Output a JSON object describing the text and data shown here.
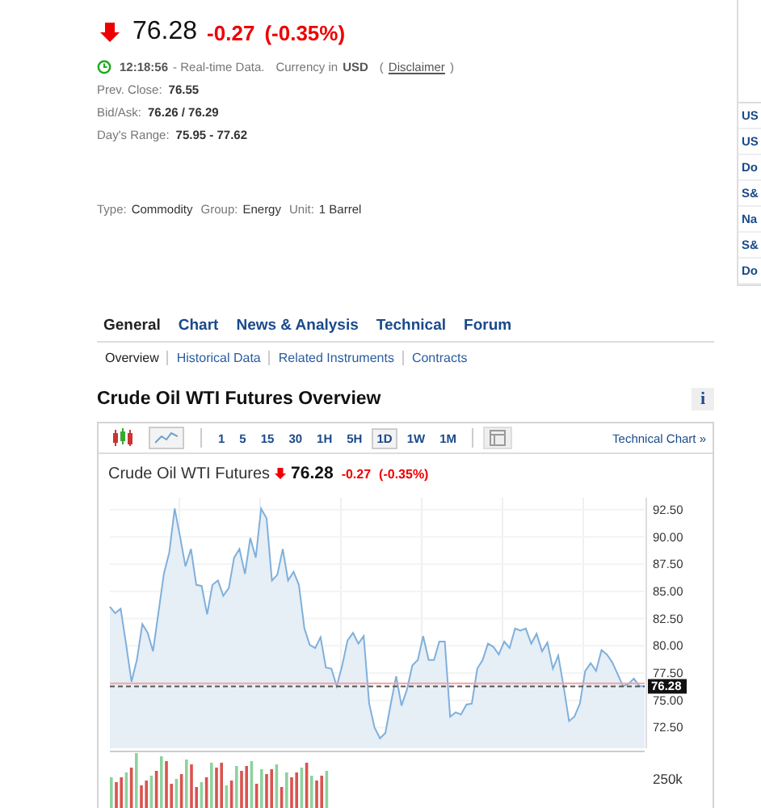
{
  "quote": {
    "falling": true,
    "price": "76.28",
    "change": "-0.27",
    "change_percent": "(-0.35%)"
  },
  "status": {
    "time": "12:18:56",
    "text": "- Real-time Data.",
    "currency_label": "Currency in",
    "currency": "USD",
    "open_paren": "(",
    "disclaimer": "Disclaimer",
    "close_paren": ")"
  },
  "stats": [
    {
      "label": "Prev. Close:",
      "value": "76.55"
    },
    {
      "label": "Bid/Ask:",
      "value": "76.26 / 76.29"
    },
    {
      "label": "Day's Range:",
      "value": "75.95 - 77.62"
    }
  ],
  "meta": [
    {
      "label": "Type:",
      "value": "Commodity"
    },
    {
      "label": "Group:",
      "value": "Energy"
    },
    {
      "label": "Unit:",
      "value": "1 Barrel"
    }
  ],
  "sidebar": {
    "items": [
      "US",
      "US",
      "Do",
      "S&",
      "Na",
      "S&",
      "Do"
    ]
  },
  "tabs": [
    {
      "label": "General",
      "selected": true
    },
    {
      "label": "Chart",
      "selected": false
    },
    {
      "label": "News & Analysis",
      "selected": false
    },
    {
      "label": "Technical",
      "selected": false
    },
    {
      "label": "Forum",
      "selected": false
    }
  ],
  "subtabs": [
    {
      "label": "Overview",
      "selected": true
    },
    {
      "label": "Historical Data",
      "selected": false
    },
    {
      "label": "Related Instruments",
      "selected": false
    },
    {
      "label": "Contracts",
      "selected": false
    }
  ],
  "section_title": "Crude Oil WTI Futures Overview",
  "info_button": "i",
  "chart": {
    "chart_types": [
      {
        "kind": "candles",
        "selected": false
      },
      {
        "kind": "area",
        "selected": true
      }
    ],
    "intervals": [
      {
        "label": "1",
        "selected": false
      },
      {
        "label": "5",
        "selected": false
      },
      {
        "label": "15",
        "selected": false
      },
      {
        "label": "30",
        "selected": false
      },
      {
        "label": "1H",
        "selected": false
      },
      {
        "label": "5H",
        "selected": false
      },
      {
        "label": "1D",
        "selected": true
      },
      {
        "label": "1W",
        "selected": false
      },
      {
        "label": "1M",
        "selected": false
      }
    ],
    "technical_link": "Technical Chart »",
    "falling": true,
    "price": "76.28",
    "change": "-0.27",
    "change_percent": "(-0.35%)",
    "volume_label": "250k",
    "chart_data": {
      "type": "area",
      "ylim": [
        70.6,
        93.6
      ],
      "yticks": [
        {
          "value": 72.5,
          "label": "72.50"
        },
        {
          "value": 75,
          "label": "75.00"
        },
        {
          "value": 77.5,
          "label": "77.50"
        },
        {
          "value": 80,
          "label": "80.00"
        },
        {
          "value": 82.5,
          "label": "82.50"
        },
        {
          "value": 85,
          "label": "85.00"
        },
        {
          "value": 87.5,
          "label": "87.50"
        },
        {
          "value": 90,
          "label": "90.00"
        },
        {
          "value": 92.5,
          "label": "92.50"
        }
      ],
      "series": [
        {
          "name": "Crude Oil WTI Futures",
          "color": "#7fb0db",
          "values": [
            83.6,
            83.0,
            83.4,
            80.2,
            76.7,
            78.7,
            82.0,
            81.2,
            79.5,
            83.1,
            86.6,
            88.6,
            92.6,
            90.0,
            87.3,
            88.9,
            85.6,
            85.5,
            82.9,
            85.6,
            86.0,
            84.6,
            85.3,
            88.1,
            88.9,
            86.6,
            89.9,
            88.1,
            92.6,
            91.7,
            86.0,
            86.5,
            88.9,
            86.0,
            86.8,
            85.6,
            81.6,
            80.1,
            79.8,
            80.8,
            78.0,
            77.9,
            76.3,
            78.2,
            80.5,
            81.2,
            80.2,
            80.9,
            74.7,
            72.5,
            71.5,
            72.0,
            74.7,
            77.2,
            74.5,
            76.0,
            78.2,
            78.7,
            80.9,
            78.7,
            78.7,
            80.4,
            80.4,
            73.5,
            73.9,
            73.7,
            74.6,
            74.7,
            77.9,
            78.7,
            80.2,
            79.9,
            79.2,
            80.4,
            79.8,
            81.6,
            81.4,
            81.6,
            80.2,
            81.1,
            79.5,
            80.3,
            77.9,
            79.1,
            76.3,
            73.1,
            73.5,
            74.7,
            77.7,
            78.4,
            77.7,
            79.6,
            79.2,
            78.5,
            77.4,
            76.3,
            76.5,
            77.0,
            76.3,
            76.3
          ]
        }
      ],
      "grid": true,
      "ref_lines": [
        {
          "axis": "y",
          "value": 76.55,
          "color": "#f4a4a4"
        },
        {
          "axis": "y",
          "value": 76.28,
          "color": "#555555"
        }
      ],
      "annotations": [
        {
          "y": 76.28,
          "text": "76.28"
        }
      ]
    }
  }
}
